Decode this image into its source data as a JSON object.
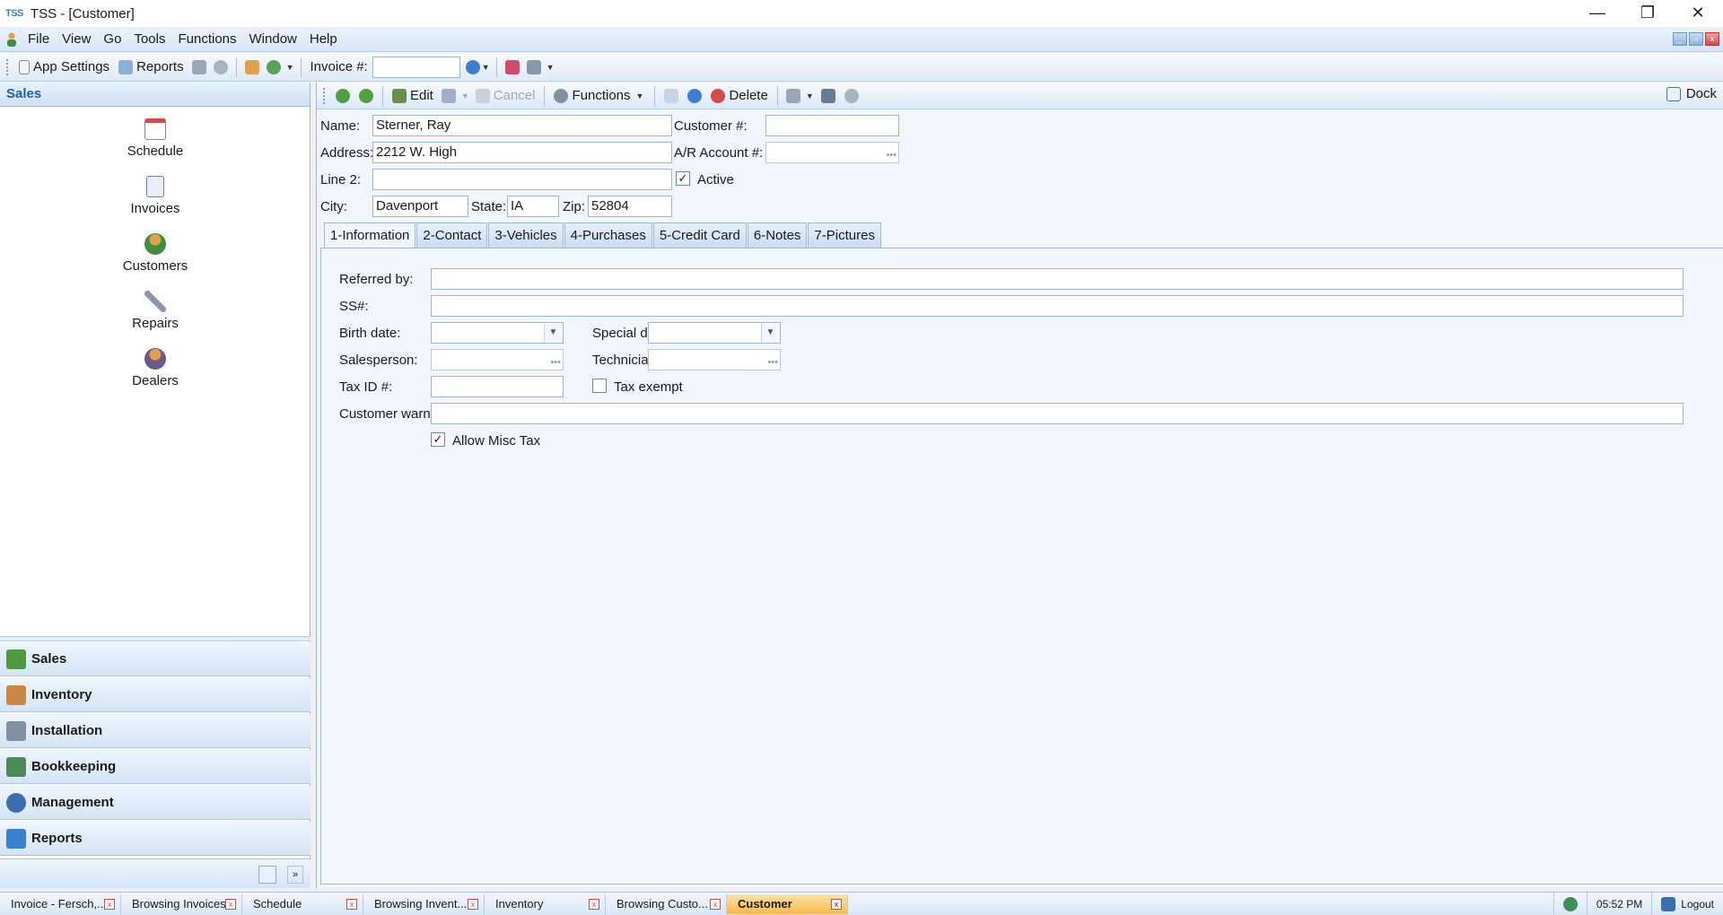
{
  "window": {
    "logo": "TSS",
    "title": "TSS - [Customer]",
    "min": "—",
    "restore": "❐",
    "close": "✕"
  },
  "menu": [
    "File",
    "View",
    "Go",
    "Tools",
    "Functions",
    "Window",
    "Help"
  ],
  "toolbar": {
    "app_settings": "App Settings",
    "reports": "Reports",
    "invoice_label": "Invoice #:",
    "invoice_value": ""
  },
  "sidebar": {
    "header": "Sales",
    "launch_items": [
      "Schedule",
      "Invoices",
      "Customers",
      "Repairs",
      "Dealers"
    ],
    "nav": [
      "Sales",
      "Inventory",
      "Installation",
      "Bookkeeping",
      "Management",
      "Reports"
    ]
  },
  "record_toolbar": {
    "edit": "Edit",
    "cancel": "Cancel",
    "functions": "Functions",
    "delete": "Delete",
    "dock": "Dock"
  },
  "customer": {
    "name_label": "Name:",
    "name": "Sterner, Ray",
    "customer_no_label": "Customer #:",
    "customer_no": "",
    "address_label": "Address:",
    "address": "2212 W. High",
    "ar_label": "A/R Account #:",
    "ar_account": "",
    "line2_label": "Line 2:",
    "line2": "",
    "active_label": "Active",
    "active": true,
    "city_label": "City:",
    "city": "Davenport",
    "state_label": "State:",
    "state": "IA",
    "zip_label": "Zip:",
    "zip": "52804"
  },
  "tabs": [
    "1-Information",
    "2-Contact",
    "3-Vehicles",
    "4-Purchases",
    "5-Credit Card",
    "6-Notes",
    "7-Pictures"
  ],
  "info": {
    "referred_label": "Referred by:",
    "referred": "",
    "ss_label": "SS#:",
    "ss": "",
    "birth_label": "Birth date:",
    "special_label": "Special date:",
    "salesperson_label": "Salesperson:",
    "technician_label": "Technician:",
    "taxid_label": "Tax ID #:",
    "tax_exempt_label": "Tax exempt",
    "tax_exempt": false,
    "warning_label": "Customer warning:",
    "warning": "",
    "misc_tax_label": "Allow Misc Tax",
    "misc_tax": true
  },
  "taskbar": {
    "tasks": [
      "Invoice - Fersch,...",
      "Browsing Invoices",
      "Schedule",
      "Browsing Invent...",
      "Inventory",
      "Browsing Custo...",
      "Customer"
    ],
    "active": "Customer",
    "time": "05:52 PM",
    "logout": "Logout"
  },
  "colors": {
    "accent": "#1f5ea8",
    "active_task": "#f7b94c",
    "close_red": "#d24a4a"
  }
}
